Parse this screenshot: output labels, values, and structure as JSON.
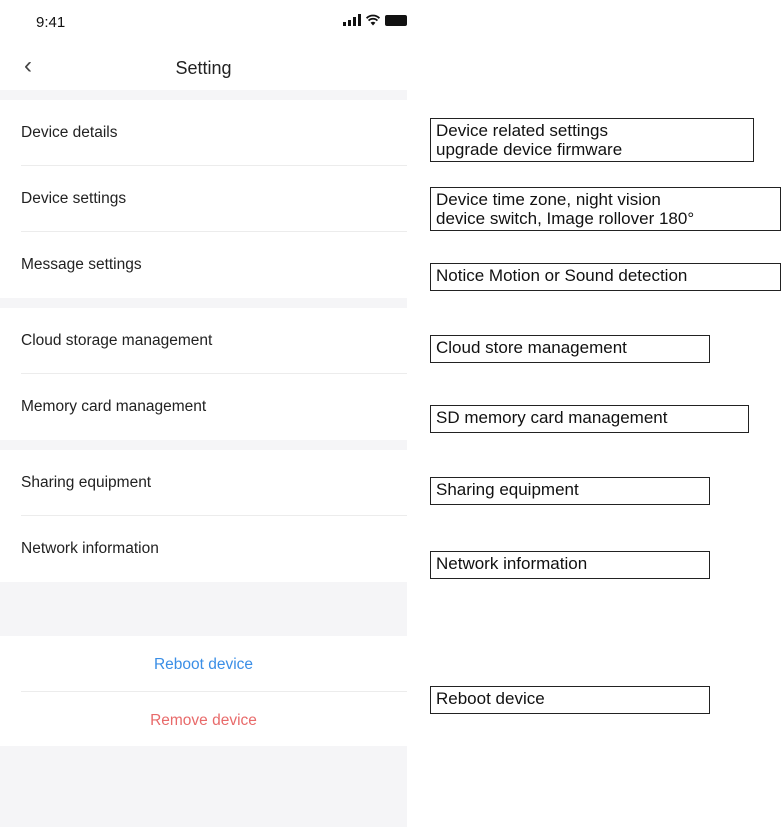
{
  "status_bar": {
    "time": "9:41"
  },
  "nav": {
    "title": "Setting"
  },
  "groups": [
    [
      {
        "label": "Device details"
      },
      {
        "label": "Device settings"
      },
      {
        "label": "Message settings"
      }
    ],
    [
      {
        "label": "Cloud storage management"
      },
      {
        "label": "Memory card management"
      }
    ],
    [
      {
        "label": "Sharing equipment"
      },
      {
        "label": "Network information"
      }
    ]
  ],
  "actions": {
    "reboot": {
      "label": "Reboot device",
      "color": "#3a8ee6"
    },
    "remove": {
      "label": "Remove device",
      "color": "#e86a6a"
    }
  },
  "annotations": [
    "Device related settings\nupgrade device firmware",
    "Device time zone,  night vision\ndevice switch, Image rollover 180°",
    "Notice Motion or Sound detection",
    "Cloud store management",
    "SD memory card management",
    "Sharing equipment",
    "Network information",
    "Reboot device"
  ],
  "icons": {
    "back": "chevron-left-icon",
    "signal": "cellular-signal-icon",
    "wifi": "wifi-icon",
    "battery": "battery-icon"
  }
}
